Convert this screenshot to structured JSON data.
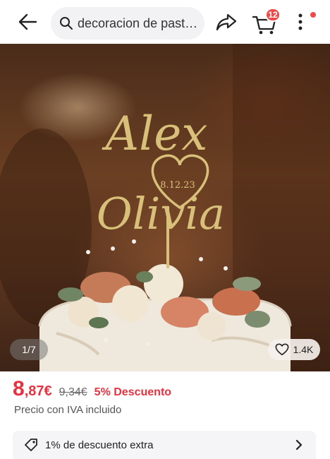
{
  "header": {
    "search_text": "decoracion de pastel...",
    "cart_count": "12"
  },
  "icons": {
    "back": "back-arrow-icon",
    "search": "search-icon",
    "share": "share-icon",
    "cart": "cart-icon",
    "more": "more-vertical-icon",
    "likes": "heart-icon",
    "tag": "tag-icon",
    "chevron": "chevron-right-icon"
  },
  "hero": {
    "topper_name_1": "Alex",
    "topper_date": "8.12.23",
    "topper_name_2": "Olivia",
    "pager": "1/7",
    "likes": "1.4K"
  },
  "price": {
    "main": "8",
    "cents": ",87€",
    "old": "9,34€",
    "discount": "5% Descuento",
    "tax_note": "Precio con IVA incluido"
  },
  "extra": {
    "label": "1% de descuento extra"
  },
  "colors": {
    "accent": "#e8323f",
    "badge": "#ef4b4b",
    "gold": "#d8c07a"
  }
}
